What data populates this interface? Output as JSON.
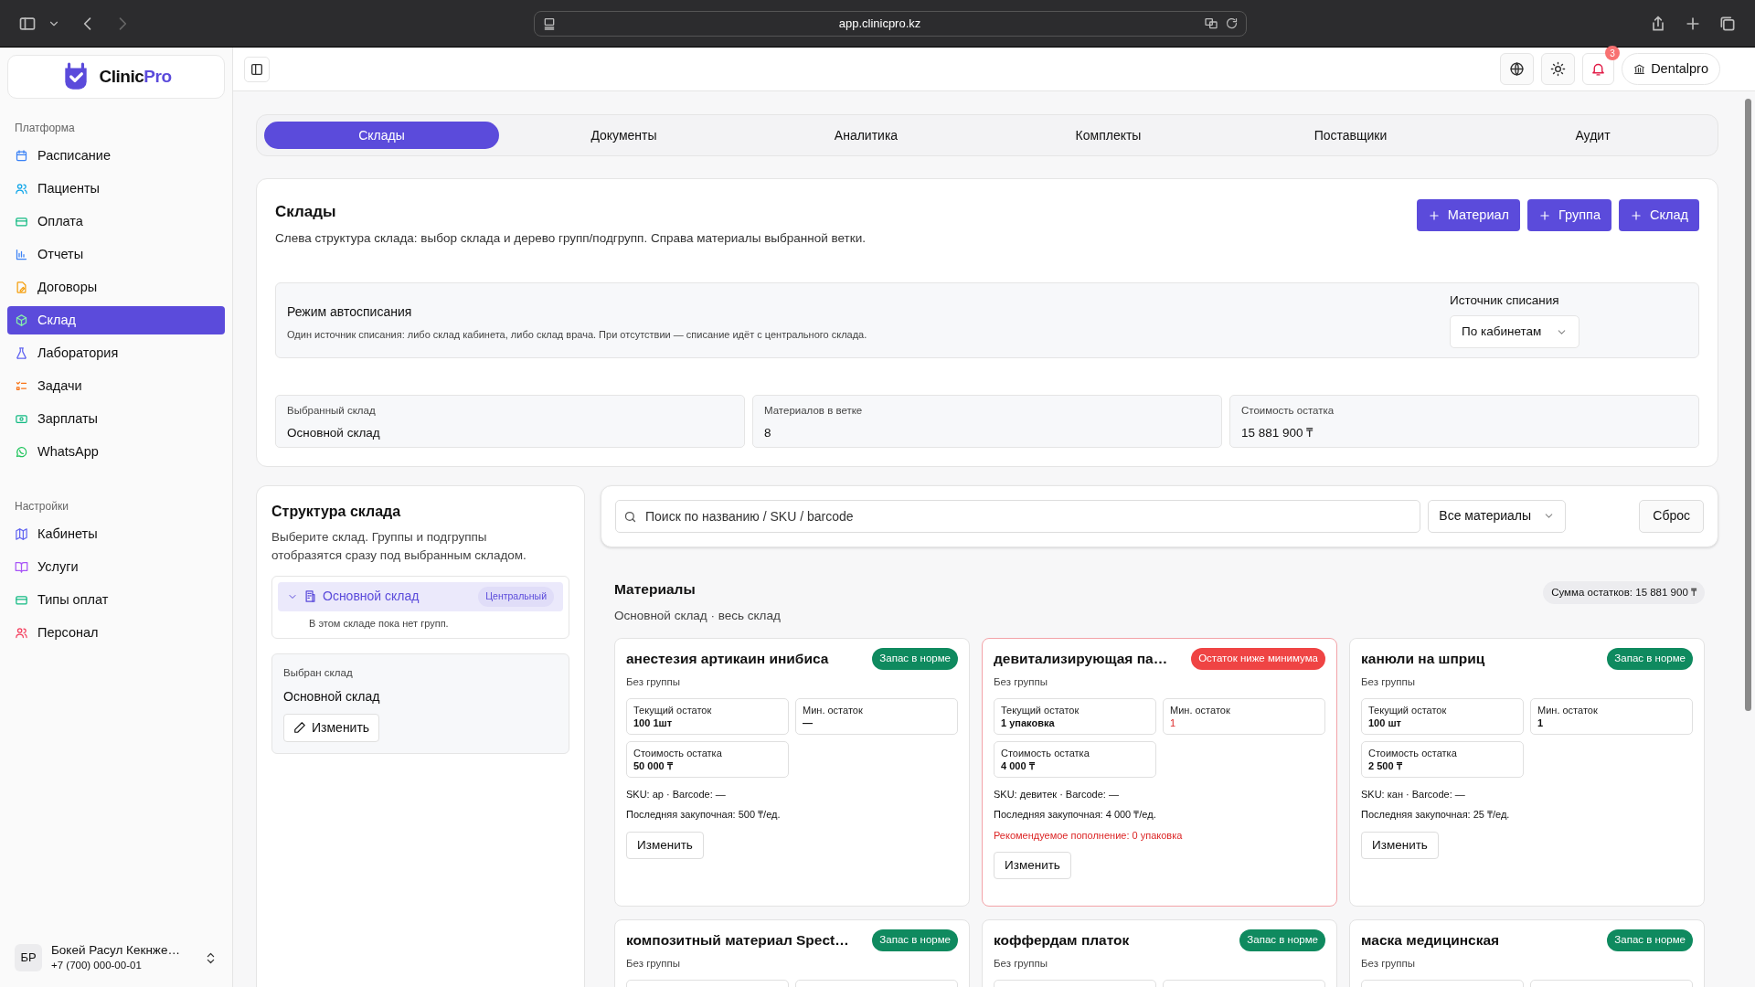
{
  "browser": {
    "url": "app.clinicpro.kz"
  },
  "sidebar": {
    "logo": {
      "main": "Clinic",
      "accent": "Pro"
    },
    "sections": [
      {
        "title": "Платформа",
        "items": [
          {
            "label": "Расписание",
            "selected": false
          },
          {
            "label": "Пациенты",
            "selected": false
          },
          {
            "label": "Оплата",
            "selected": false
          },
          {
            "label": "Отчеты",
            "selected": false
          },
          {
            "label": "Договоры",
            "selected": false
          },
          {
            "label": "Склад",
            "selected": true
          },
          {
            "label": "Лаборатория",
            "selected": false
          },
          {
            "label": "Задачи",
            "selected": false
          },
          {
            "label": "Зарплаты",
            "selected": false
          },
          {
            "label": "WhatsApp",
            "selected": false
          }
        ]
      },
      {
        "title": "Настройки",
        "items": [
          {
            "label": "Кабинеты",
            "selected": false
          },
          {
            "label": "Услуги",
            "selected": false
          },
          {
            "label": "Типы оплат",
            "selected": false
          },
          {
            "label": "Персонал",
            "selected": false
          }
        ]
      }
    ],
    "user": {
      "initials": "БР",
      "name": "Бокей Расул Кекнже…",
      "phone": "+7 (700) 000-00-01"
    }
  },
  "header": {
    "notifications": "3",
    "workspace": "Dentalpro"
  },
  "tabs": [
    {
      "label": "Склады",
      "selected": true
    },
    {
      "label": "Документы",
      "selected": false
    },
    {
      "label": "Аналитика",
      "selected": false
    },
    {
      "label": "Комплекты",
      "selected": false
    },
    {
      "label": "Поставщики",
      "selected": false
    },
    {
      "label": "Аудит",
      "selected": false
    }
  ],
  "warehouses": {
    "title": "Склады",
    "description": "Слева структура склада: выбор склада и дерево групп/подгрупп. Справа материалы выбранной ветки.",
    "buttons": [
      "Материал",
      "Группа",
      "Склад"
    ],
    "autowriteoff": {
      "title": "Режим автосписания",
      "description": "Один источник списания: либо склад кабинета, либо склад врача. При отсутствии — списание идёт с центрального склада.",
      "source_label": "Источник списания",
      "source_value": "По кабинетам"
    },
    "stats": [
      {
        "label": "Выбранный склад",
        "value": "Основной склад"
      },
      {
        "label": "Материалов в ветке",
        "value": "8"
      },
      {
        "label": "Стоимость остатка",
        "value": "15 881 900 ₸"
      }
    ]
  },
  "structure": {
    "title": "Структура склада",
    "description": "Выберите склад. Группы и подгруппы отобразятся сразу под выбранным складом.",
    "tree": [
      {
        "label": "Основной склад",
        "badge": "Центральный",
        "selected": true,
        "expanded": true,
        "empty_note": "В этом складе пока нет групп."
      }
    ],
    "selected_box": {
      "label": "Выбран склад",
      "value": "Основной склад",
      "button": "Изменить"
    }
  },
  "filters": {
    "placeholder": "Поиск по названию / SKU / barcode",
    "category": "Все материалы",
    "reset": "Сброс"
  },
  "materials": {
    "title": "Материалы",
    "subtitle": "Основной склад · весь склад",
    "total": "Сумма остатков: 15 881 900 ₸",
    "cards": [
      {
        "name": "анестезия артикаин инибиса",
        "status": {
          "label": "Запас в норме",
          "kind": "ok"
        },
        "group": "Без группы",
        "stats": [
          {
            "label": "Текущий остаток",
            "value": "100 1шт",
            "alert": false
          },
          {
            "label": "Мин. остаток",
            "value": "—",
            "alert": false
          },
          {
            "label": "Стоимость остатка",
            "value": "50 000 ₸",
            "alert": false
          }
        ],
        "sku": "SKU: ар · Barcode: —",
        "last_price": "Последняя закупочная: 500 ₸/ед.",
        "button": "Изменить"
      },
      {
        "name": "девитализирующая па…",
        "status": {
          "label": "Остаток ниже минимума",
          "kind": "low"
        },
        "group": "Без группы",
        "stats": [
          {
            "label": "Текущий остаток",
            "value": "1 упаковка",
            "alert": false
          },
          {
            "label": "Мин. остаток",
            "value": "1",
            "alert": true
          },
          {
            "label": "Стоимость остатка",
            "value": "4 000 ₸",
            "alert": false
          }
        ],
        "sku": "SKU: девитек · Barcode: —",
        "last_price": "Последняя закупочная: 4 000 ₸/ед.",
        "recommendation": "Рекомендуемое пополнение: 0 упаковка",
        "button": "Изменить"
      },
      {
        "name": "канюли на шприц",
        "status": {
          "label": "Запас в норме",
          "kind": "ok"
        },
        "group": "Без группы",
        "stats": [
          {
            "label": "Текущий остаток",
            "value": "100 шт",
            "alert": false
          },
          {
            "label": "Мин. остаток",
            "value": "1",
            "alert": false
          },
          {
            "label": "Стоимость остатка",
            "value": "2 500 ₸",
            "alert": false
          }
        ],
        "sku": "SKU: кан · Barcode: —",
        "last_price": "Последняя закупочная: 25 ₸/ед.",
        "button": "Изменить"
      },
      {
        "name": "композитный материал Spect…",
        "status": {
          "label": "Запас в норме",
          "kind": "ok"
        },
        "group": "Без группы"
      },
      {
        "name": "коффердам платок",
        "status": {
          "label": "Запас в норме",
          "kind": "ok"
        },
        "group": "Без группы"
      },
      {
        "name": "маска медицинская",
        "status": {
          "label": "Запас в норме",
          "kind": "ok"
        },
        "group": "Без группы"
      }
    ]
  }
}
